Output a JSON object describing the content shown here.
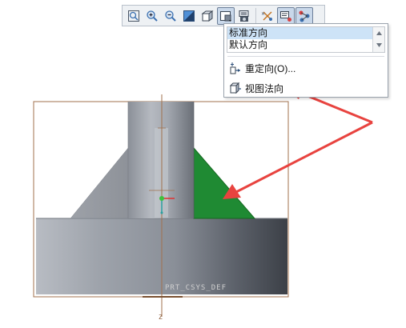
{
  "toolbar": {
    "buttons": [
      {
        "name": "refit-icon",
        "pressed": false
      },
      {
        "name": "zoom-in-icon",
        "pressed": false
      },
      {
        "name": "zoom-out-icon",
        "pressed": false
      },
      {
        "name": "shading-icon",
        "pressed": false
      },
      {
        "name": "saved-orientations-icon",
        "pressed": false
      },
      {
        "name": "view-manager-icon",
        "pressed": true
      },
      {
        "name": "display-style-icon",
        "pressed": false
      },
      {
        "name": "datum-display-icon",
        "pressed": false
      },
      {
        "name": "annotation-display-icon",
        "pressed": false
      },
      {
        "name": "spin-center-icon",
        "pressed": false
      }
    ]
  },
  "view_menu": {
    "list_items": [
      "标准方向",
      "默认方向"
    ],
    "selected_item": "标准方向",
    "reorient_label": "重定向(O)...",
    "normal_view_label": "视图法向"
  },
  "viewport": {
    "coord_label": "PRT_CSYS_DEF",
    "axis_label": "Z",
    "selected_face_color": "#1f8a33",
    "frame_color": "#a0704c",
    "arrow_color": "#e8433f"
  }
}
